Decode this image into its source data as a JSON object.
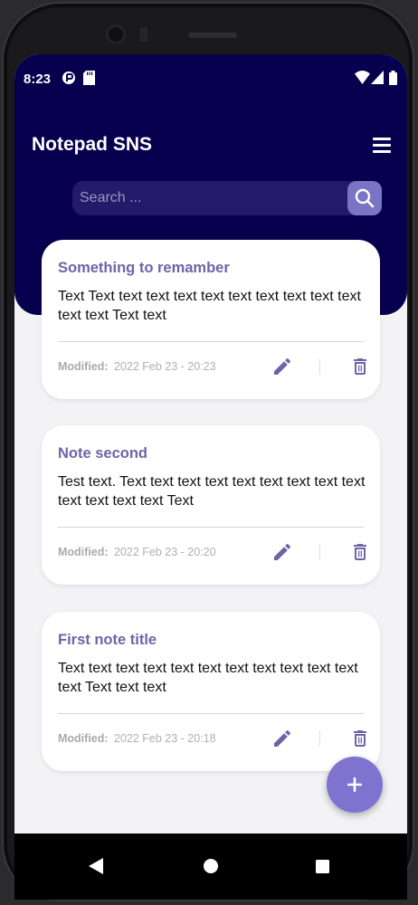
{
  "status_bar": {
    "time": "8:23",
    "icons": [
      "media-icon",
      "sd-card-icon",
      "wifi-icon",
      "signal-icon",
      "battery-icon"
    ]
  },
  "app_bar": {
    "title": "Notepad SNS",
    "menu_icon": "hamburger-menu-icon"
  },
  "search": {
    "placeholder": "Search ...",
    "button_icon": "search-icon"
  },
  "notes": [
    {
      "title": "Something to remamber",
      "body": "Text Text text text text text text text text text text text text Text text",
      "modified_label": "Modified:",
      "modified_date": "2022 Feb 23 - 20:23"
    },
    {
      "title": "Note second",
      "body": "Test text. Text text text text text text text text text text text text text Text",
      "modified_label": "Modified:",
      "modified_date": "2022 Feb 23 - 20:20"
    },
    {
      "title": "First note title",
      "body": "Text text text text text text text text text text text text Text text text",
      "modified_label": "Modified:",
      "modified_date": "2022 Feb 23 - 20:18"
    }
  ],
  "fab": {
    "icon": "plus-icon"
  },
  "nav_bar": {
    "icons": [
      "back-icon",
      "home-icon",
      "recents-icon"
    ]
  },
  "colors": {
    "header": "#07004e",
    "accent": "#7e74cf",
    "note_title": "#6f63a8",
    "background": "#f3f2f5"
  }
}
